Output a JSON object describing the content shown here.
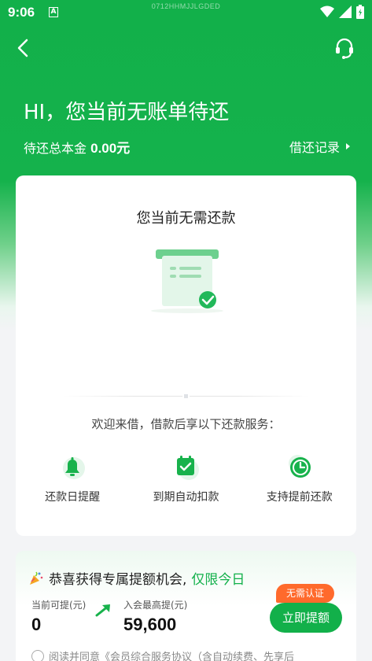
{
  "status": {
    "time": "9:06",
    "notif_letter": "A",
    "device_id": "0712HHMJJLGDED"
  },
  "header": {
    "headline": "HI，您当前无账单待还",
    "principal_label": "待还总本金",
    "principal_amount": "0.00元",
    "records_label": "借还记录"
  },
  "card": {
    "title": "您当前无需还款",
    "welcome": "欢迎来借，借款后享以下还款服务：",
    "features": [
      {
        "icon": "bell-icon",
        "label": "还款日提醒"
      },
      {
        "icon": "calendar-check-icon",
        "label": "到期自动扣款"
      },
      {
        "icon": "clock-check-icon",
        "label": "支持提前还款"
      }
    ]
  },
  "promo": {
    "title_prefix": "恭喜获得专属提额机会,",
    "title_highlight": "仅限今日",
    "current_label": "当前可提(元)",
    "current_value": "0",
    "member_label": "入会最高提(元)",
    "member_value": "59,600",
    "badge": "无需认证",
    "button": "立即提额",
    "agreement": "阅读并同意《会员综合服务协议（含自动续费、先享后"
  },
  "colors": {
    "brand_green": "#12b04a",
    "badge_orange": "#ff6a2c"
  }
}
